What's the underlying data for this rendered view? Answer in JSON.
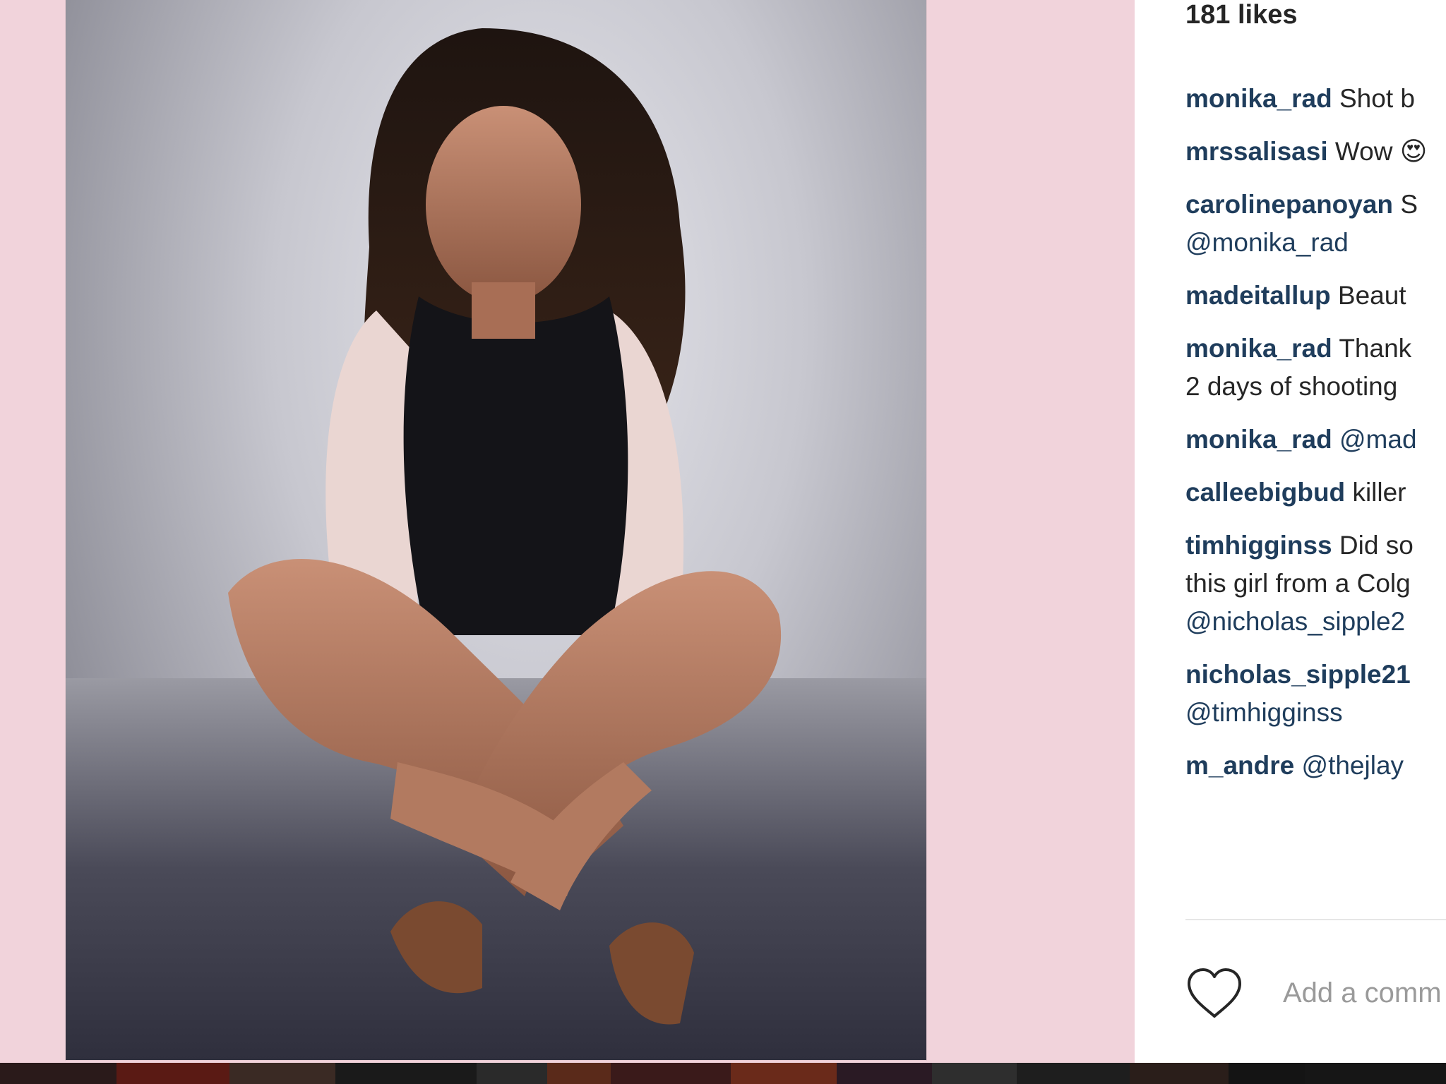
{
  "post": {
    "likes": "181 likes"
  },
  "comments": [
    {
      "user": "monika_rad",
      "text": "Shot b"
    },
    {
      "user": "mrssalisasi",
      "text": "Wow 😍"
    },
    {
      "user": "carolinepanoyan",
      "text": "S",
      "line2": "@monika_rad"
    },
    {
      "user": "madeitallup",
      "text": "Beaut"
    },
    {
      "user": "monika_rad",
      "text": "Thank",
      "line2": "2 days of shooting"
    },
    {
      "user": "monika_rad",
      "text": "@mad"
    },
    {
      "user": "calleebigbud",
      "text": "killer"
    },
    {
      "user": "timhigginss",
      "text": "Did so",
      "line2": "this girl from a Colg",
      "line3": "@nicholas_sipple2"
    },
    {
      "user": "nicholas_sipple21",
      "text": "",
      "line2": "@timhigginss"
    },
    {
      "user": "m_andre",
      "text": "@thejlay"
    }
  ],
  "add_comment": {
    "placeholder": "Add a comm"
  },
  "icons": {
    "like": "heart-outline-icon"
  },
  "colors": {
    "username": "#1f3d5c",
    "media_background": "#f1d3db",
    "bottom_strip": "#161616"
  }
}
